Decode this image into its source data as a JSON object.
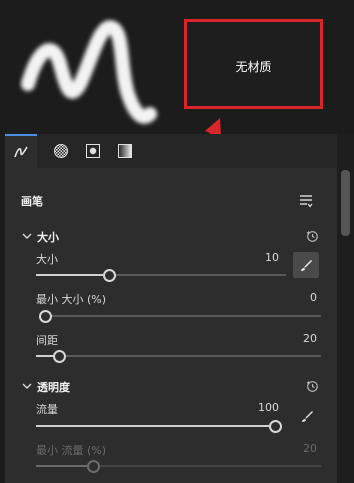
{
  "preview": {
    "no_material_label": "无材质"
  },
  "tabs": [
    {
      "name": "brush-tip-tab"
    },
    {
      "name": "texture-tab"
    },
    {
      "name": "mask-tab"
    },
    {
      "name": "gradient-tab"
    }
  ],
  "panel": {
    "title": "画笔",
    "size_section": {
      "title": "大小",
      "size": {
        "label": "大小",
        "value": "10",
        "fraction": 0.29
      },
      "min_size": {
        "label": "最小 大小 (%)",
        "value": "0",
        "fraction": 0.0
      },
      "spacing": {
        "label": "间距",
        "value": "20",
        "fraction": 0.08
      }
    },
    "opacity_section": {
      "title": "透明度",
      "flow": {
        "label": "流量",
        "value": "100",
        "fraction": 1.0
      },
      "min_flow": {
        "label": "最小 流量 (%)",
        "value": "20",
        "fraction": 0.2
      }
    }
  },
  "colors": {
    "accent": "#4a8fe0",
    "highlight_box": "#d9262b"
  }
}
